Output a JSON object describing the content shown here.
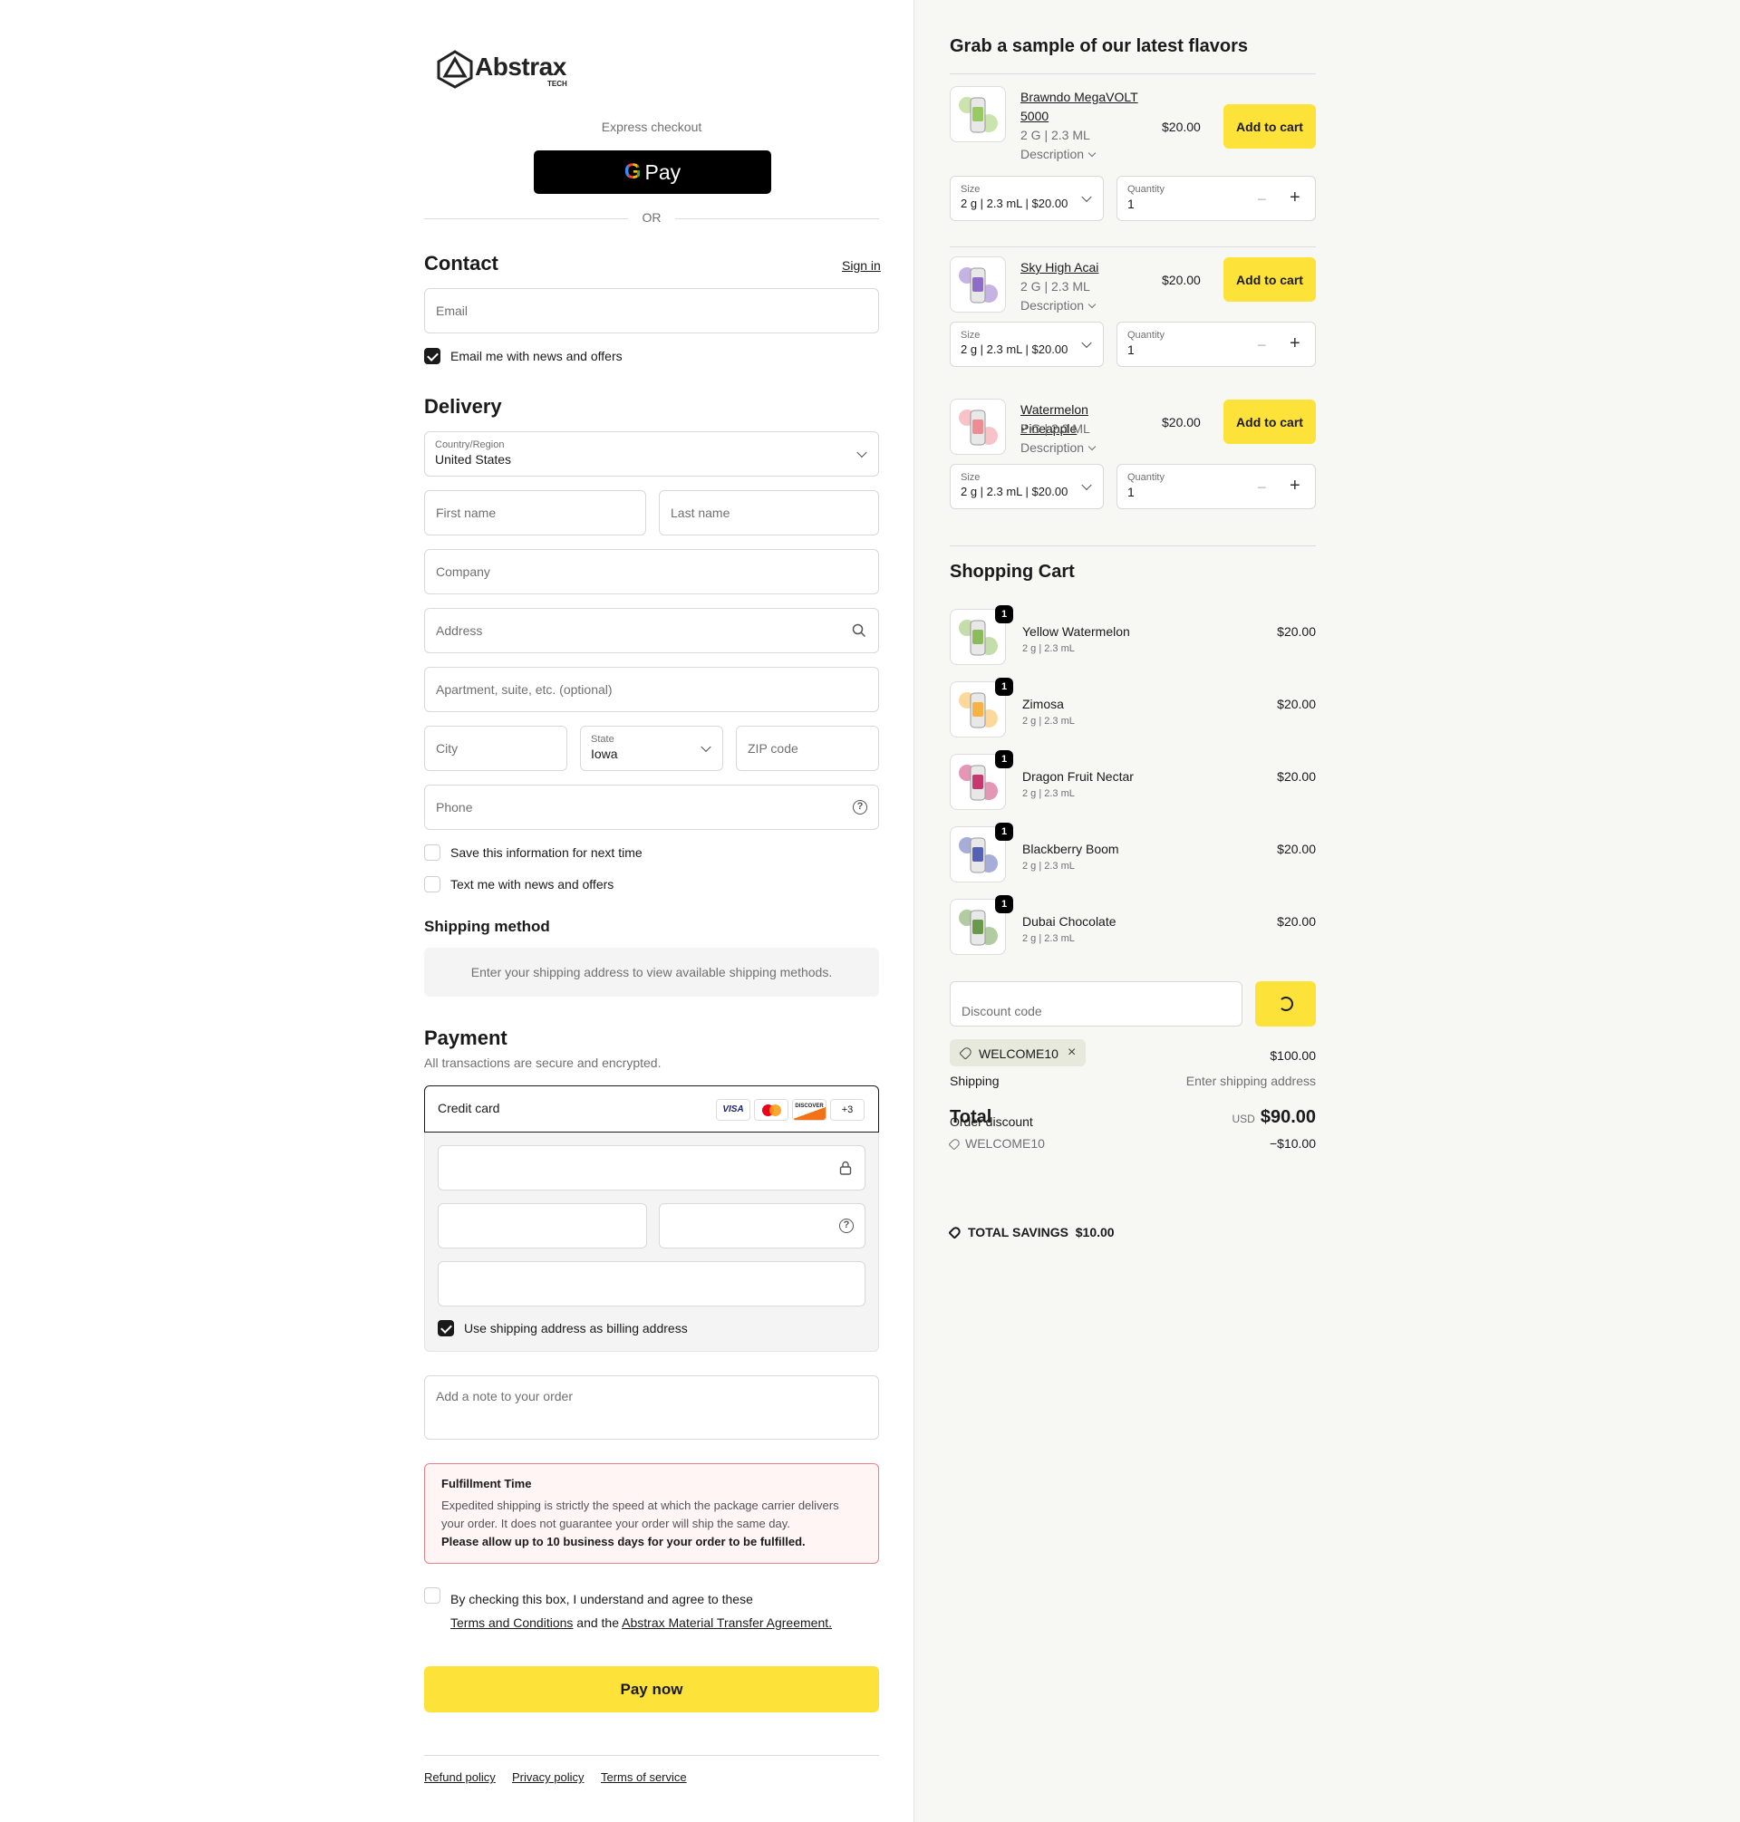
{
  "brand": {
    "name": "Abstrax",
    "sub": "TECH"
  },
  "express": {
    "label": "Express checkout",
    "gpay": "Pay",
    "or": "OR"
  },
  "contact": {
    "title": "Contact",
    "sign_in": "Sign in",
    "email_placeholder": "Email",
    "news_label": "Email me with news and offers",
    "news_checked": true
  },
  "delivery": {
    "title": "Delivery",
    "country_label": "Country/Region",
    "country_value": "United States",
    "first_name": "First name",
    "last_name": "Last name",
    "company": "Company",
    "address": "Address",
    "apartment": "Apartment, suite, etc. (optional)",
    "city": "City",
    "state_label": "State",
    "state_value": "Iowa",
    "zip": "ZIP code",
    "phone": "Phone",
    "save_info": "Save this information for next time",
    "text_me": "Text me with news and offers"
  },
  "shipping_method": {
    "title": "Shipping method",
    "message": "Enter your shipping address to view available shipping methods."
  },
  "payment": {
    "title": "Payment",
    "subtitle": "All transactions are secure and encrypted.",
    "method": "Credit card",
    "cards": [
      "VISA",
      "Mastercard",
      "DISCOVER",
      "+3"
    ],
    "billing_label": "Use shipping address as billing address",
    "note_placeholder": "Add a note to your order"
  },
  "fulfillment": {
    "title": "Fulfillment Time",
    "body": "Expedited shipping is strictly the speed at which the package carrier delivers your order. It does not guarantee your order will ship the same day.",
    "bold": "Please allow up to 10 business days for your order to be fulfilled."
  },
  "agreement": {
    "prefix": "By checking this box, I understand and agree to these",
    "terms": "Terms and Conditions",
    "and": "and the",
    "mta": "Abstrax Material Transfer Agreement."
  },
  "pay_now": "Pay now",
  "footer": [
    "Refund policy",
    "Privacy policy",
    "Terms of service"
  ],
  "upsell": {
    "title": "Grab a sample of our latest flavors",
    "items": [
      {
        "name_l1": "Brawndo MegaVOLT",
        "name_l2": "5000",
        "spec": "2 G | 2.3 ML",
        "desc": "Description",
        "price": "$20.00",
        "btn": "Add to cart",
        "size_label": "Size",
        "size_value": "2 g | 2.3 mL | $20.00",
        "qty_label": "Quantity",
        "qty_value": "1",
        "color": "#8bc34a"
      },
      {
        "name_l1": "Sky High Acai",
        "spec": "2 G | 2.3 ML",
        "desc": "Description",
        "price": "$20.00",
        "btn": "Add to cart",
        "size_label": "Size",
        "size_value": "2 g | 2.3 mL | $20.00",
        "qty_label": "Quantity",
        "qty_value": "1",
        "color": "#7e57c2"
      },
      {
        "name_l1": "Watermelon Pineapple",
        "spec": "2 G | 2.3 ML",
        "desc": "Description",
        "price": "$20.00",
        "btn": "Add to cart",
        "size_label": "Size",
        "size_value": "2 g | 2.3 mL | $20.00",
        "qty_label": "Quantity",
        "qty_value": "1",
        "color": "#ef7a85"
      }
    ]
  },
  "cart": {
    "title": "Shopping Cart",
    "items": [
      {
        "name": "Yellow Watermelon",
        "spec": "2 g | 2.3 mL",
        "price": "$20.00",
        "qty": "1",
        "color": "#7cb342"
      },
      {
        "name": "Zimosa",
        "spec": "2 g | 2.3 mL",
        "price": "$20.00",
        "qty": "1",
        "color": "#f9a825"
      },
      {
        "name": "Dragon Fruit Nectar",
        "spec": "2 g | 2.3 mL",
        "price": "$20.00",
        "qty": "1",
        "color": "#c2185b"
      },
      {
        "name": "Blackberry Boom",
        "spec": "2 g | 2.3 mL",
        "price": "$20.00",
        "qty": "1",
        "color": "#3949ab"
      },
      {
        "name": "Dubai Chocolate",
        "spec": "2 g | 2.3 mL",
        "price": "$20.00",
        "qty": "1",
        "color": "#558b2f"
      }
    ],
    "discount_placeholder": "Discount code",
    "code": "WELCOME10",
    "subtotal": "$100.00",
    "shipping_label": "Shipping",
    "shipping_value": "Enter shipping address",
    "total_label": "Total",
    "currency": "USD",
    "total": "$90.00",
    "order_discount_label": "Order discount",
    "discount_code": "WELCOME10",
    "discount_amount": "−$10.00",
    "savings_label": "TOTAL SAVINGS",
    "savings_value": "$10.00"
  },
  "colors": {
    "accent": "#fde23a",
    "dark": "#1a1a1a",
    "alert_border": "#e8808a",
    "alert_bg": "#fff5f5"
  }
}
